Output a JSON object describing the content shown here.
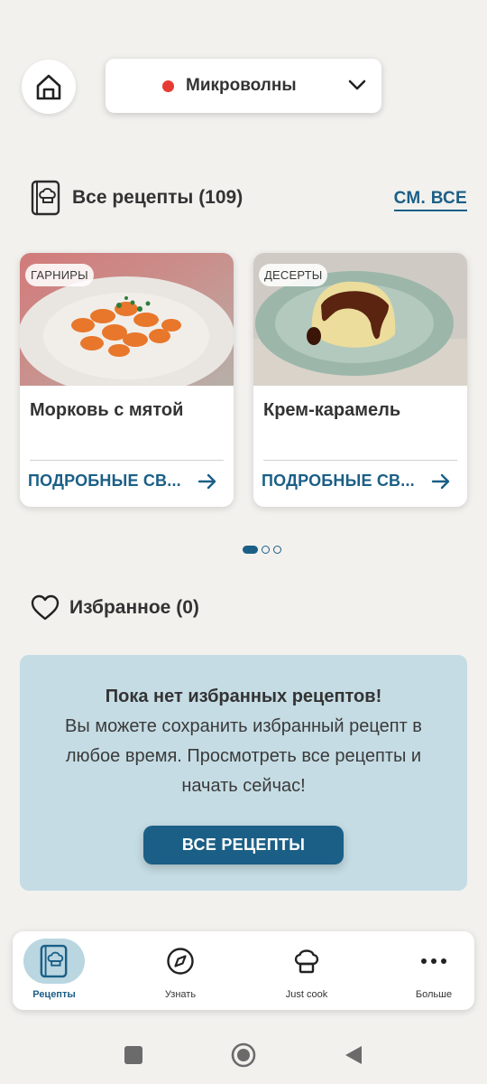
{
  "header": {
    "mode": {
      "label": "Микроволны",
      "indicator_color": "#e63b33"
    }
  },
  "recipes_section": {
    "title": "Все рецепты (109)",
    "see_all": "СМ. ВСЕ",
    "cards": [
      {
        "tag": "ГАРНИРЫ",
        "title": "Морковь с мятой",
        "link": "ПОДРОБНЫЕ СВ..."
      },
      {
        "tag": "ДЕСЕРТЫ",
        "title": "Крем-карамель",
        "link": "ПОДРОБНЫЕ СВ..."
      }
    ],
    "pager": {
      "pages": 3,
      "current": 1
    }
  },
  "favorites_section": {
    "title": "Избранное (0)",
    "empty_title": "Пока нет избранных рецептов!",
    "empty_text": "Вы можете сохранить избранный рецепт в любое время. Просмотреть все рецепты и начать сейчас!",
    "button": "ВСЕ РЕЦЕПТЫ"
  },
  "bottom_nav": {
    "items": [
      {
        "label": "Рецепты",
        "icon": "recipe-book-icon",
        "active": true
      },
      {
        "label": "Узнать",
        "icon": "compass-icon",
        "active": false
      },
      {
        "label": "Just cook",
        "icon": "chef-hat-icon",
        "active": false
      },
      {
        "label": "Больше",
        "icon": "more-dots-icon",
        "active": false
      }
    ]
  },
  "colors": {
    "accent": "#1b5f86",
    "background": "#f2f1ee",
    "empty_box": "#c5dce4",
    "active_nav": "#b9d6e1"
  }
}
